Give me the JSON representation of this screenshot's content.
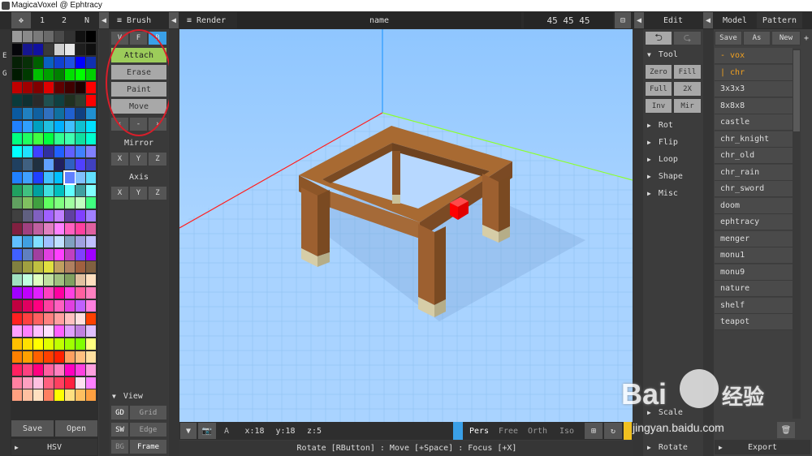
{
  "window": {
    "title": "MagicaVoxel @ Ephtracy"
  },
  "top": {
    "move_icon": "move-icon",
    "tab1": "1",
    "tab2": "2",
    "tabN": "N",
    "brush": "Brush",
    "render": "Render",
    "name": "name",
    "size": "45 45 45",
    "edit": "Edit",
    "model": "Model",
    "pattern": "Pattern"
  },
  "palette_side": {
    "e": "E",
    "g": "G"
  },
  "palette": {
    "save": "Save",
    "open": "Open",
    "hsv": "HSV",
    "selected_index": 93,
    "colors": [
      "#9a9a9a",
      "#8a8a8a",
      "#7a7a7a",
      "#6a6a6a",
      "#4a4a4a",
      "#333",
      "#111",
      "#000",
      "#05050a",
      "#161690",
      "#1111a0",
      "#3a3a3a",
      "#cfcfcf",
      "#e8e8e8",
      "#1e1e1e",
      "#101010",
      "#062006",
      "#083008",
      "#006000",
      "#0a60c0",
      "#1040d0",
      "#2050e0",
      "#0000ff",
      "#1030b0",
      "#001a00",
      "#003a00",
      "#00c000",
      "#00a000",
      "#008000",
      "#00e000",
      "#00ff00",
      "#00d000",
      "#c00000",
      "#a00000",
      "#800000",
      "#e00000",
      "#600000",
      "#400000",
      "#200000",
      "#ff0000",
      "#0a3a3a",
      "#103030",
      "#2a2a2a",
      "#205050",
      "#104040",
      "#203020",
      "#304030",
      "#ff0000",
      "#0a5aa0",
      "#2080c0",
      "#1060a0",
      "#3070c0",
      "#1070a0",
      "#2060d0",
      "#104080",
      "#2090d0",
      "#2080ff",
      "#30a0ff",
      "#00a0c0",
      "#20c0e0",
      "#00b0ff",
      "#40c0ff",
      "#10c0d0",
      "#00e0ff",
      "#00ff80",
      "#20ff60",
      "#40ff40",
      "#00ff40",
      "#30ff90",
      "#40ffb0",
      "#10e0a0",
      "#00ffd0",
      "#00ffff",
      "#20e0ff",
      "#4040ff",
      "#3030a0",
      "#2060ff",
      "#6060ff",
      "#4080ff",
      "#8080ff",
      "#204060",
      "#406080",
      "#203040",
      "#60a0ff",
      "#202060",
      "#3060c0",
      "#5040ff",
      "#4040c0",
      "#2080ff",
      "#40a0ff",
      "#2040ff",
      "#40c0ff",
      "#00c0ff",
      "#6080ff",
      "#80c0ff",
      "#60e0ff",
      "#20a060",
      "#40c080",
      "#00a0a0",
      "#40e0e0",
      "#00c0c0",
      "#60ffff",
      "#40a0a0",
      "#80ffff",
      "#60a060",
      "#80c060",
      "#40a040",
      "#60ff60",
      "#80ff80",
      "#a0ffa0",
      "#c0ffc0",
      "#40ff80",
      "#404040",
      "#606080",
      "#8060c0",
      "#a060ff",
      "#c080ff",
      "#6040a0",
      "#8040ff",
      "#a080ff",
      "#802040",
      "#a04080",
      "#c060a0",
      "#e080c0",
      "#ff80ff",
      "#ff60c0",
      "#ff40a0",
      "#e060a0",
      "#60c0ff",
      "#40a0e0",
      "#80e0ff",
      "#a0c0ff",
      "#c0e0ff",
      "#80a0c0",
      "#a0a0e0",
      "#c0c0ff",
      "#4060ff",
      "#6080c0",
      "#a040a0",
      "#e040e0",
      "#ff40ff",
      "#c040c0",
      "#8040ff",
      "#a000ff",
      "#808040",
      "#a0a040",
      "#c0c040",
      "#e0e040",
      "#c0a060",
      "#b08060",
      "#a06040",
      "#806040",
      "#a0e0c0",
      "#c0ffe0",
      "#e0ffc0",
      "#c0e0a0",
      "#a0c080",
      "#80a060",
      "#e0c0a0",
      "#ffe0c0",
      "#a000ff",
      "#c000ff",
      "#e020ff",
      "#ff40c0",
      "#ff00a0",
      "#ff40e0",
      "#ff60a0",
      "#ff80c0",
      "#c00040",
      "#e00060",
      "#ff0080",
      "#ff40a0",
      "#ff60c0",
      "#e040e0",
      "#c060ff",
      "#ff80e0",
      "#ff2020",
      "#ff4040",
      "#ff6060",
      "#ff8080",
      "#ffa0a0",
      "#ffc0c0",
      "#ffe0e0",
      "#ff4000",
      "#ffa0ff",
      "#ff80ff",
      "#ffc0ff",
      "#ffe0ff",
      "#ff60ff",
      "#e0a0ff",
      "#c080e0",
      "#e0c0ff",
      "#ffc000",
      "#ffe000",
      "#ffff00",
      "#e0ff00",
      "#c0ff00",
      "#a0ff00",
      "#80ff00",
      "#ffff80",
      "#ff8000",
      "#ffa000",
      "#ff6000",
      "#ff4000",
      "#ff2000",
      "#ffa060",
      "#ffc080",
      "#ffe0a0",
      "#ff2060",
      "#ff4080",
      "#ff0080",
      "#ff60a0",
      "#ff80c0",
      "#ff00c0",
      "#ff40e0",
      "#ffa0e0",
      "#ff80a0",
      "#ffa0c0",
      "#ffc0e0",
      "#ff6080",
      "#ff4060",
      "#ff2040",
      "#ffe0f0",
      "#ff80ff",
      "#ffa080",
      "#ffc0a0",
      "#ffe0c0",
      "#ff8060",
      "#ffff00",
      "#ffe080",
      "#ffc060",
      "#ffa040"
    ]
  },
  "brush": {
    "v": "V",
    "f": "F",
    "b": "B",
    "attach": "Attach",
    "erase": "Erase",
    "paint": "Paint",
    "move": "Move",
    "lt": "‹",
    "mid": "-",
    "gt": "›",
    "mirror": "Mirror",
    "axis": "Axis",
    "x": "X",
    "y": "Y",
    "z": "Z",
    "view": "View",
    "gd": "GD",
    "grid": "Grid",
    "sw": "SW",
    "edge": "Edge",
    "bg": "BG",
    "frame": "Frame"
  },
  "bottom": {
    "a": "A",
    "xcoord": "x:18",
    "ycoord": "y:18",
    "zcoord": "z:5",
    "pers": "Pers",
    "free": "Free",
    "orth": "Orth",
    "iso": "Iso",
    "hint": "Rotate [RButton] : Move [+Space] : Focus [+X]"
  },
  "edit": {
    "tool": "Tool",
    "zero": "Zero",
    "fill": "Fill",
    "full": "Full",
    "x2": "2X",
    "inv": "Inv",
    "mir": "Mir",
    "rot": "Rot",
    "flip": "Flip",
    "loop": "Loop",
    "shape": "Shape",
    "misc": "Misc",
    "scale": "Scale",
    "rotate": "Rotate"
  },
  "model": {
    "save": "Save",
    "as": "As",
    "new": "New",
    "add": "+",
    "items": [
      "- vox",
      "| chr",
      "3x3x3",
      "8x8x8",
      "castle",
      "chr_knight",
      "chr_old",
      "chr_rain",
      "chr_sword",
      "doom",
      "ephtracy",
      "menger",
      "monu1",
      "monu9",
      "nature",
      "shelf",
      "teapot"
    ],
    "export": "Export"
  },
  "watermark": {
    "brand_a": "Bai",
    "brand_b": "经验",
    "url": "jingyan.baidu.com"
  },
  "colors": {
    "accent_green": "#9ccc5a",
    "accent_blue": "#3aa0e8",
    "sky": "#9fcfff"
  }
}
